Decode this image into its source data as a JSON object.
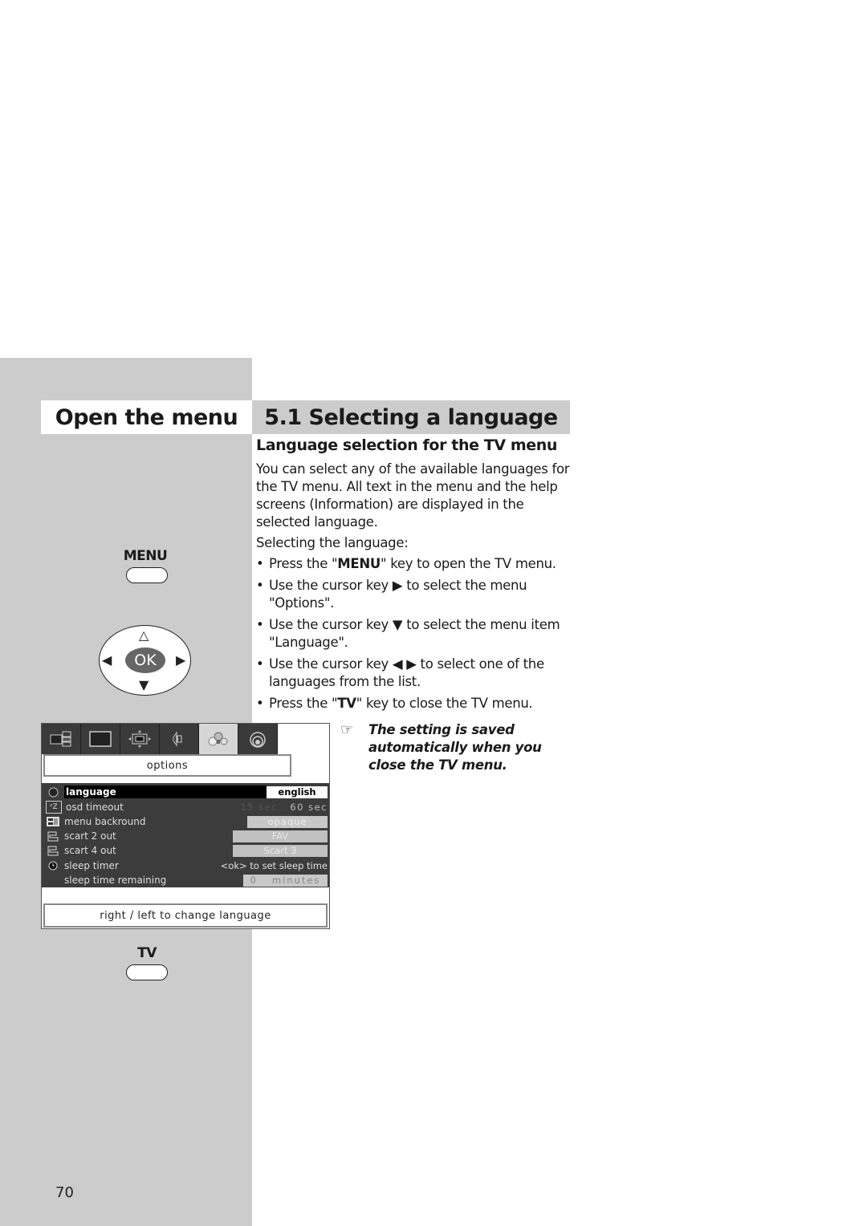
{
  "page": {
    "left_title": "Open the menu",
    "right_title": "5.1 Selecting a language",
    "page_number": "70"
  },
  "section": {
    "subtitle": "Language selection for the TV menu",
    "intro": "You can select any of the available languages for the TV menu. All text in the menu and the help screens (Information) are displayed in the selected language.",
    "steps_heading": "Selecting the language:",
    "steps": [
      {
        "prefix": "Press the \"",
        "key": "MENU",
        "suffix": "\" key to open the TV menu."
      },
      {
        "prefix": "Use the cursor key ",
        "symbol": "▶",
        "suffix": " to select the menu \"Options\"."
      },
      {
        "prefix": "Use the cursor key ",
        "symbol": "▼",
        "suffix": " to select the menu item \"Language\"."
      },
      {
        "prefix": "Use the cursor key ",
        "symbol": "◀ ▶",
        "suffix": " to select one of the languages from the list."
      },
      {
        "prefix": "Press the \"",
        "key": "TV",
        "suffix": "\" key to close the TV menu."
      }
    ],
    "bullet": "•",
    "note_icon": "☞",
    "note": "The setting is saved automatically when you close the TV menu."
  },
  "remote": {
    "menu_label": "MENU",
    "ok_label": "OK",
    "tv_label": "TV",
    "arrows": {
      "up": "△",
      "down": "▼",
      "left": "◀",
      "right": "▶"
    }
  },
  "tv_menu": {
    "tabs": [
      {
        "name": "picture-in-picture",
        "active": false
      },
      {
        "name": "picture",
        "active": false
      },
      {
        "name": "format",
        "active": false
      },
      {
        "name": "sound",
        "active": false
      },
      {
        "name": "options",
        "active": true
      },
      {
        "name": "channels",
        "active": false
      }
    ],
    "title": "options",
    "rows": [
      {
        "icon": "globe",
        "label": "language",
        "value": "english",
        "selected": true
      },
      {
        "icon": "zz",
        "label": "osd timeout",
        "value": "60 sec",
        "value_prev": "15 sec"
      },
      {
        "icon": "grid",
        "label": "menu backround",
        "value": "opaque"
      },
      {
        "icon": "scart",
        "label": "scart 2 out",
        "value": "FAV"
      },
      {
        "icon": "scart",
        "label": "scart 4 out",
        "value": "Scart 3"
      },
      {
        "icon": "clock",
        "label": "sleep timer",
        "value": "<ok> to set sleep time"
      },
      {
        "icon": "",
        "label": "sleep time remaining",
        "value_num": "0",
        "value": "minutes"
      }
    ],
    "hint": "right / left to change language",
    "icons": {
      "zz": "ᶻZ"
    }
  }
}
